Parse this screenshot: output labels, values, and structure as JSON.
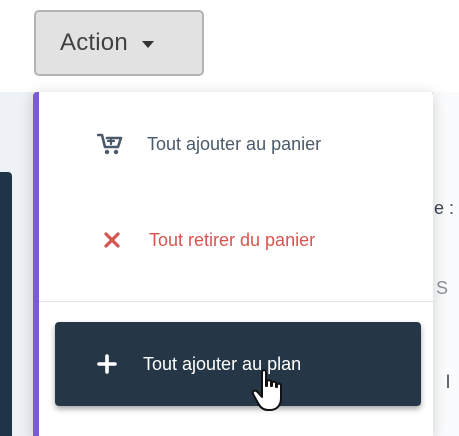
{
  "action_button": {
    "label": "Action",
    "icon": "caret-down-icon"
  },
  "menu": {
    "accent_color": "#7b5cd6",
    "items": [
      {
        "label": "Tout ajouter au panier",
        "icon": "cart-add-icon",
        "color": "#4a5a6b"
      },
      {
        "label": "Tout retirer du panier",
        "icon": "close-icon",
        "color": "#d9534f"
      }
    ],
    "primary_action": {
      "label": "Tout ajouter au plan",
      "icon": "plus-icon",
      "background": "#253746",
      "state": "hovered"
    }
  },
  "cursor": {
    "type": "hand-pointer"
  },
  "background_fragments": {
    "right_edge_texts": [
      "e :",
      "S",
      "l"
    ]
  }
}
